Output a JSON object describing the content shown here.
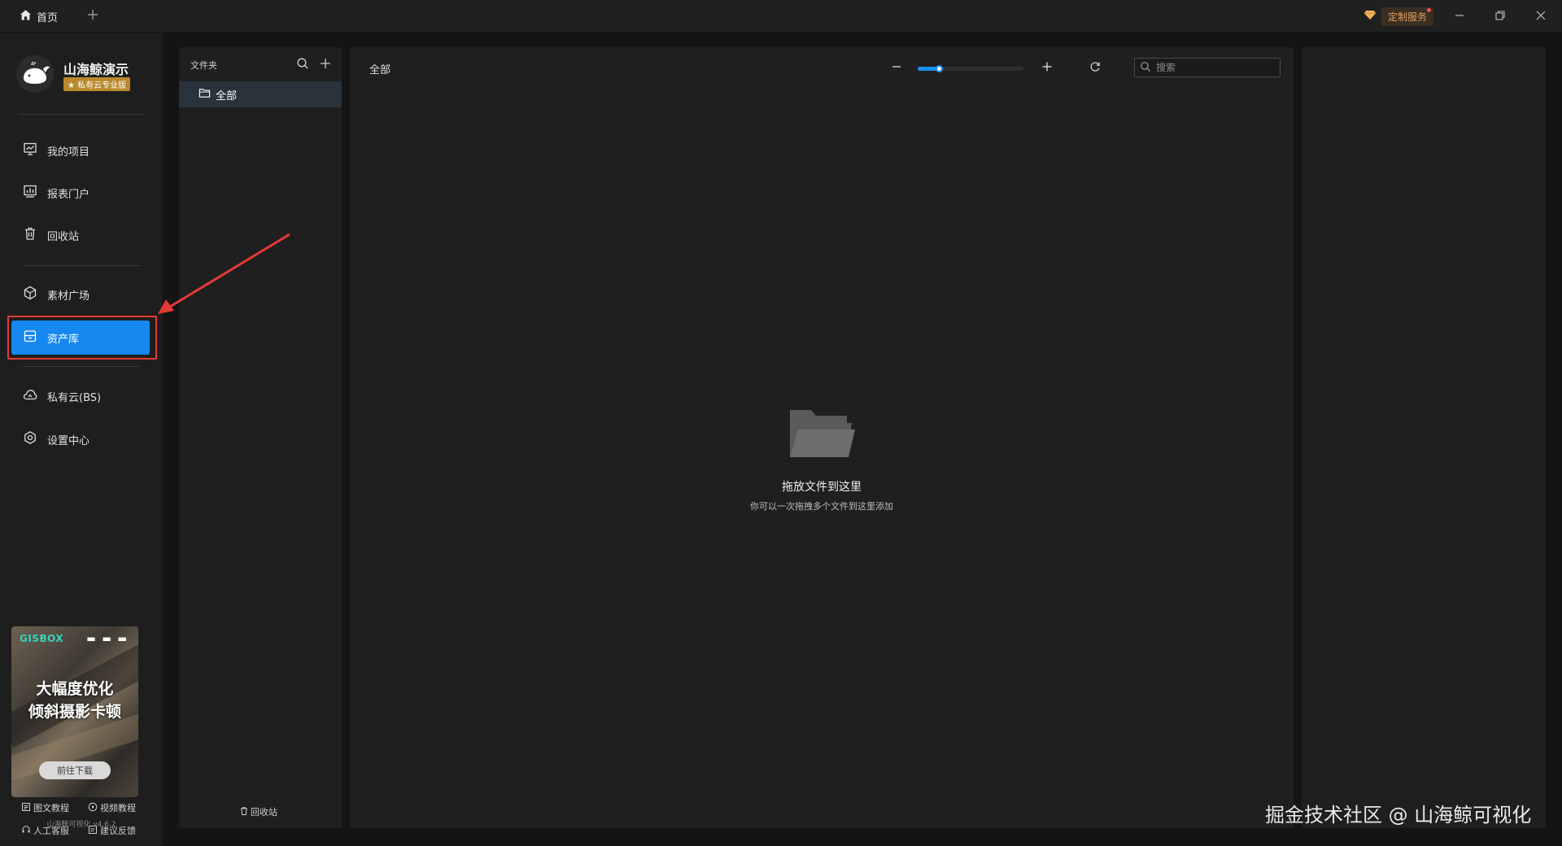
{
  "titlebar": {
    "home_tab": "首页",
    "custom_service": "定制服务"
  },
  "sidebar": {
    "brand_name": "山海鲸演示",
    "edition_badge": "★ 私有云专业版",
    "items": [
      {
        "label": "我的项目"
      },
      {
        "label": "报表门户"
      },
      {
        "label": "回收站"
      },
      {
        "label": "素材广场"
      },
      {
        "label": "资产库"
      },
      {
        "label": "私有云(BS)"
      },
      {
        "label": "设置中心"
      }
    ],
    "active_item": "资产库",
    "promo": {
      "logo": "GISBOX",
      "line1": "大幅度优化",
      "line2": "倾斜摄影卡顿",
      "button": "前往下载"
    },
    "help_links": {
      "text_tutorial": "图文教程",
      "video_tutorial": "视频教程",
      "human_support": "人工客服",
      "feedback": "建议反馈"
    },
    "version": "山海鲸可视化 v4.6.2"
  },
  "folder_panel": {
    "title": "文件夹",
    "folder_all": "全部",
    "recycle_bin": "回收站"
  },
  "main_panel": {
    "title": "全部",
    "zoom_level_fraction": 0.2,
    "search_placeholder": "搜索",
    "empty_title": "拖放文件到这里",
    "empty_subtitle": "你可以一次拖拽多个文件到这里添加"
  },
  "watermark": "掘金技术社区 @ 山海鲸可视化",
  "colors": {
    "accent": "#1788f0",
    "annotation_red": "#e53935",
    "edition_gold": "#b88a2c",
    "service_orange": "#e2a05b"
  }
}
